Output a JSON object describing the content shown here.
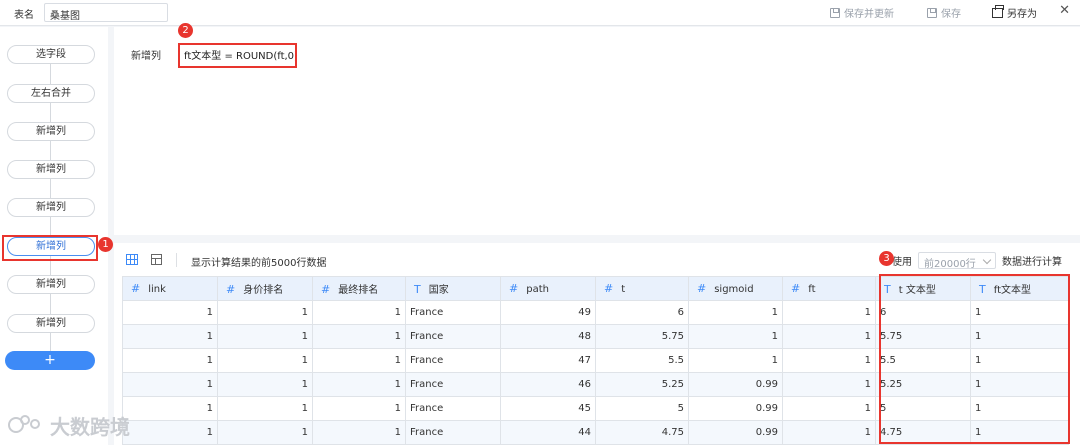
{
  "topbar": {
    "table_name_label": "表名",
    "table_name_value": "桑基图",
    "save_update_label": "保存并更新",
    "save_label": "保存",
    "save_as_label": "另存为",
    "close_label": "✕"
  },
  "steps": [
    "选字段",
    "左右合并",
    "新增列",
    "新增列",
    "新增列",
    "新增列",
    "新增列",
    "新增列"
  ],
  "add_step_label": "+",
  "formula": {
    "label": "新增列",
    "expression": "ft文本型 = ROUND(ft,0)"
  },
  "table_toolbar": {
    "note": "显示计算结果的前5000行数据",
    "use_label": "使用",
    "use_select_value": "前20000行",
    "use_suffix": "数据进行计算"
  },
  "table": {
    "columns": [
      {
        "type_icon": "#",
        "name": "link"
      },
      {
        "type_icon": "#",
        "name": "身价排名"
      },
      {
        "type_icon": "#",
        "name": "最终排名"
      },
      {
        "type_icon": "T",
        "name": "国家"
      },
      {
        "type_icon": "#",
        "name": "path"
      },
      {
        "type_icon": "#",
        "name": "t"
      },
      {
        "type_icon": "#",
        "name": "sigmoid"
      },
      {
        "type_icon": "#",
        "name": "ft"
      },
      {
        "type_icon": "T",
        "name": "t 文本型"
      },
      {
        "type_icon": "T",
        "name": "ft文本型"
      }
    ],
    "rows": [
      [
        "1",
        "1",
        "1",
        "France",
        "49",
        "6",
        "1",
        "1",
        "6",
        "1"
      ],
      [
        "1",
        "1",
        "1",
        "France",
        "48",
        "5.75",
        "1",
        "1",
        "5.75",
        "1"
      ],
      [
        "1",
        "1",
        "1",
        "France",
        "47",
        "5.5",
        "1",
        "1",
        "5.5",
        "1"
      ],
      [
        "1",
        "1",
        "1",
        "France",
        "46",
        "5.25",
        "0.99",
        "1",
        "5.25",
        "1"
      ],
      [
        "1",
        "1",
        "1",
        "France",
        "45",
        "5",
        "0.99",
        "1",
        "5",
        "1"
      ],
      [
        "1",
        "1",
        "1",
        "France",
        "44",
        "4.75",
        "0.99",
        "1",
        "4.75",
        "1"
      ]
    ],
    "text_columns": [
      3,
      8,
      9
    ]
  },
  "annotations": {
    "badge1": "1",
    "badge2": "2",
    "badge3": "3",
    "color": "#e8352e"
  },
  "watermark": "大数跨境",
  "accent_color": "#3d8af7"
}
